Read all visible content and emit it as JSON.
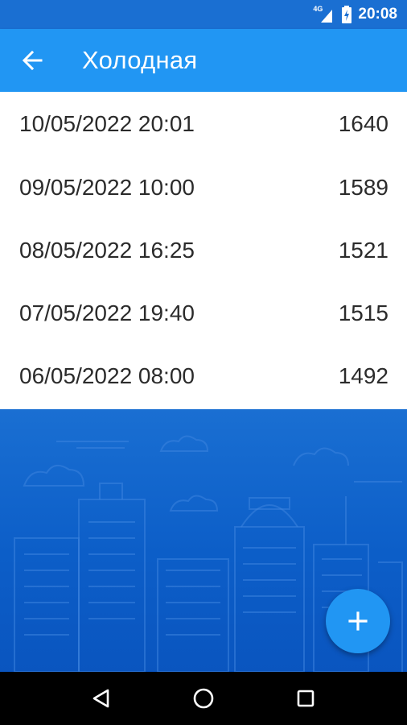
{
  "status_bar": {
    "network_label": "4G",
    "time": "20:08"
  },
  "app_bar": {
    "title": "Холодная",
    "back_icon": "arrow-left-icon"
  },
  "readings": [
    {
      "datetime": "10/05/2022 20:01",
      "value": "1640"
    },
    {
      "datetime": "09/05/2022 10:00",
      "value": "1589"
    },
    {
      "datetime": "08/05/2022 16:25",
      "value": "1521"
    },
    {
      "datetime": "07/05/2022 19:40",
      "value": "1515"
    },
    {
      "datetime": "06/05/2022 08:00",
      "value": "1492"
    }
  ],
  "fab": {
    "icon": "plus-icon"
  },
  "nav_bar": {
    "icons": [
      "back-triangle-icon",
      "home-circle-icon",
      "recents-square-icon"
    ]
  },
  "colors": {
    "app_bar": "#2196f3",
    "status_bar": "#1a6fd2",
    "background": "#0a5fc9",
    "fab": "#2196f3",
    "row_text": "#2b2b2b"
  }
}
